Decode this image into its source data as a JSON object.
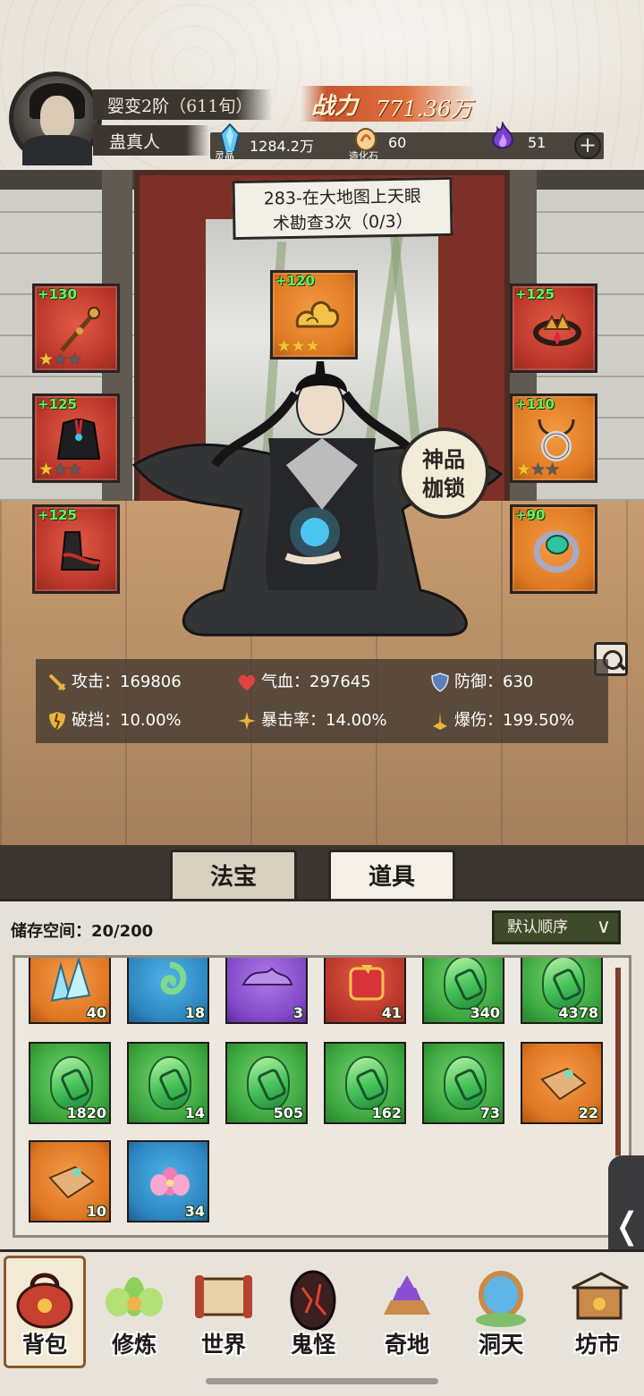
{
  "player": {
    "realm": "婴变2阶",
    "age": "（611旬）",
    "name": "蛊真人"
  },
  "power": {
    "label": "战力",
    "value": "771.36万"
  },
  "resources": {
    "crystal": {
      "value": "1284.2万",
      "label": "灵晶",
      "icon": "blue-crystal-icon"
    },
    "stone": {
      "value": "60",
      "label": "造化石",
      "icon": "stone-icon"
    },
    "flame": {
      "value": "51",
      "icon": "purple-flame-icon"
    }
  },
  "quest": {
    "line1": "283-在大地图上天眼",
    "line2": "术勘查3次（0/3）"
  },
  "equipment": [
    {
      "slot": "weapon",
      "level": "+130",
      "stars": 1,
      "rarity": "red",
      "icon": "staff-icon"
    },
    {
      "slot": "treasure",
      "level": "+120",
      "stars": 3,
      "rarity": "orange",
      "icon": "golden-cloud-icon"
    },
    {
      "slot": "headband",
      "level": "+125",
      "stars": 0,
      "rarity": "red",
      "icon": "crown-icon"
    },
    {
      "slot": "armor",
      "level": "+125",
      "stars": 1,
      "rarity": "red",
      "icon": "robe-icon"
    },
    {
      "slot": "necklace",
      "level": "+110",
      "stars": 1,
      "rarity": "orange",
      "icon": "pendant-icon"
    },
    {
      "slot": "boots",
      "level": "+125",
      "stars": 0,
      "rarity": "red",
      "icon": "boots-icon"
    },
    {
      "slot": "ring",
      "level": "+90",
      "stars": 0,
      "rarity": "orange",
      "icon": "ring-icon"
    }
  ],
  "badge": {
    "line1": "神品",
    "line2": "枷锁"
  },
  "stats": [
    {
      "label": "攻击：169806",
      "icon": "sword-icon"
    },
    {
      "label": "气血：297645",
      "icon": "heart-icon"
    },
    {
      "label": "防御：630",
      "icon": "shield-icon"
    },
    {
      "label": "破挡：10.00%",
      "icon": "broken-shield-icon"
    },
    {
      "label": "暴击率：14.00%",
      "icon": "crit-icon"
    },
    {
      "label": "爆伤：199.50%",
      "icon": "burst-icon"
    }
  ],
  "tabs": [
    {
      "label": "法宝"
    },
    {
      "label": "道具"
    }
  ],
  "inventory": {
    "storage": "储存空间：20/200",
    "sort": "默认顺序",
    "items": [
      {
        "count": "40",
        "rarity": "orange",
        "icon": "ice-crystal-icon"
      },
      {
        "count": "18",
        "rarity": "blue",
        "icon": "jade-swirl-icon"
      },
      {
        "count": "3",
        "rarity": "purple",
        "icon": "purple-cloth-icon"
      },
      {
        "count": "41",
        "rarity": "red",
        "icon": "red-talisman-icon"
      },
      {
        "count": "340",
        "rarity": "green",
        "icon": "jade-slip-icon"
      },
      {
        "count": "4378",
        "rarity": "green",
        "icon": "jade-slip-icon"
      },
      {
        "count": "1820",
        "rarity": "green",
        "icon": "jade-slip-icon"
      },
      {
        "count": "14",
        "rarity": "green",
        "icon": "jade-slip-icon"
      },
      {
        "count": "505",
        "rarity": "green",
        "icon": "jade-slip-icon"
      },
      {
        "count": "162",
        "rarity": "green",
        "icon": "jade-slip-icon"
      },
      {
        "count": "73",
        "rarity": "green",
        "icon": "jade-slip-icon"
      },
      {
        "count": "22",
        "rarity": "orange",
        "icon": "puzzle-piece-icon"
      },
      {
        "count": "10",
        "rarity": "orange",
        "icon": "puzzle-piece-icon"
      },
      {
        "count": "34",
        "rarity": "blue",
        "icon": "lotus-icon"
      }
    ]
  },
  "nav": [
    {
      "label": "背包",
      "icon": "bag-icon"
    },
    {
      "label": "修炼",
      "icon": "lotus-cultivate-icon"
    },
    {
      "label": "世界",
      "icon": "scroll-map-icon"
    },
    {
      "label": "鬼怪",
      "icon": "demon-egg-icon"
    },
    {
      "label": "奇地",
      "icon": "pagoda-icon"
    },
    {
      "label": "洞天",
      "icon": "portal-icon"
    },
    {
      "label": "坊市",
      "icon": "market-icon"
    }
  ],
  "colors": {
    "accent_power": "#c8542f",
    "level_green": "#64f25a",
    "star_gold": "#f3c233"
  }
}
